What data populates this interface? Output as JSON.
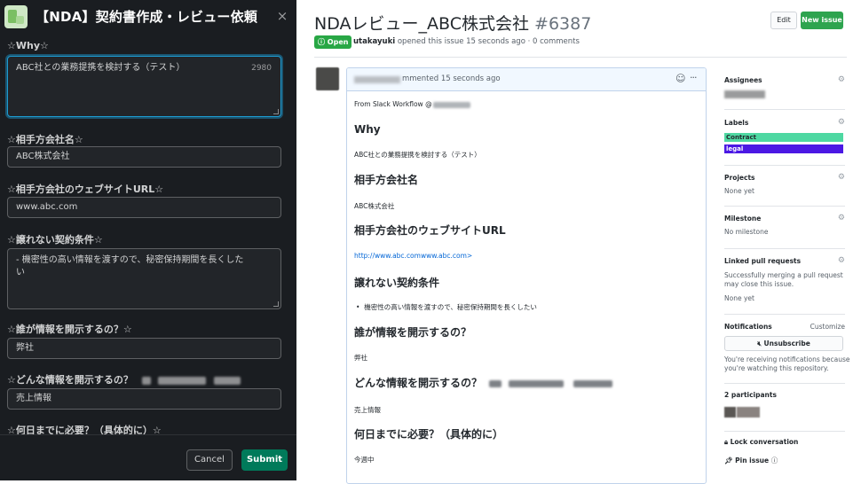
{
  "slack_modal": {
    "title": "【NDA】契約書作成・レビュー依頼",
    "close_glyph": "×",
    "fields": [
      {
        "label": "☆Why☆",
        "value": "ABC社との業務提携を検討する（テスト）",
        "counter": "2980"
      },
      {
        "label": "☆相手方会社名☆",
        "value": "ABC株式会社"
      },
      {
        "label": "☆相手方会社のウェブサイトURL☆",
        "value": "www.abc.com"
      },
      {
        "label": "☆譲れない契約条件☆",
        "value": "- 機密性の高い情報を渡すので、秘密保持期間を長くしたい"
      },
      {
        "label": "☆誰が情報を開示するの？☆",
        "value": "弊社"
      },
      {
        "label": "☆どんな情報を開示するの？",
        "value": "売上情報"
      },
      {
        "label": "☆何日までに必要？（具体的に）☆"
      }
    ],
    "cancel_label": "Cancel",
    "submit_label": "Submit"
  },
  "issue": {
    "title": "NDAレビュー_ABC株式会社",
    "number": "#6387",
    "edit_label": "Edit",
    "new_issue_label": "New issue",
    "state": "Open",
    "author": "utakayuki",
    "opened_text": "opened this issue 15 seconds ago · 0 comments",
    "comment": {
      "header_text": "mmented 15 seconds ago",
      "from_text": "From Slack Workflow @",
      "sections": [
        {
          "heading": "Why",
          "body": "ABC社との業務提携を検討する（テスト）"
        },
        {
          "heading": "相手方会社名",
          "body": "ABC株式会社"
        },
        {
          "heading": "相手方会社のウェブサイトURL",
          "body": "http://www.abc.comwww.abc.com>"
        },
        {
          "heading": "譲れない契約条件",
          "body": "機密性の高い情報を渡すので、秘密保持期間を長くしたい"
        },
        {
          "heading": "誰が情報を開示するの？",
          "body": "弊社"
        },
        {
          "heading": "どんな情報を開示するの？",
          "body": "売上情報"
        },
        {
          "heading": "何日までに必要？（具体的に）",
          "body": "今週中"
        }
      ]
    }
  },
  "sidebar": {
    "assignees_title": "Assignees",
    "labels_title": "Labels",
    "labels": [
      {
        "name": "Contract",
        "color": "#4ed8a2",
        "text_color": "#24292e"
      },
      {
        "name": "legal",
        "color": "#4b18e4",
        "text_color": "#ffffff"
      }
    ],
    "projects_title": "Projects",
    "projects_value": "None yet",
    "milestone_title": "Milestone",
    "milestone_value": "No milestone",
    "linked_title": "Linked pull requests",
    "linked_desc_1": "Successfully merging a pull request",
    "linked_desc_2": "may close this issue.",
    "linked_value": "None yet",
    "notifications_title": "Notifications",
    "customize_label": "Customize",
    "unsubscribe_label": "Unsubscribe",
    "notify_desc_1": "You're receiving notifications because",
    "notify_desc_2": "you're watching this repository.",
    "participants_title": "2 participants",
    "lock_label": "Lock conversation",
    "pin_label": "Pin issue"
  }
}
